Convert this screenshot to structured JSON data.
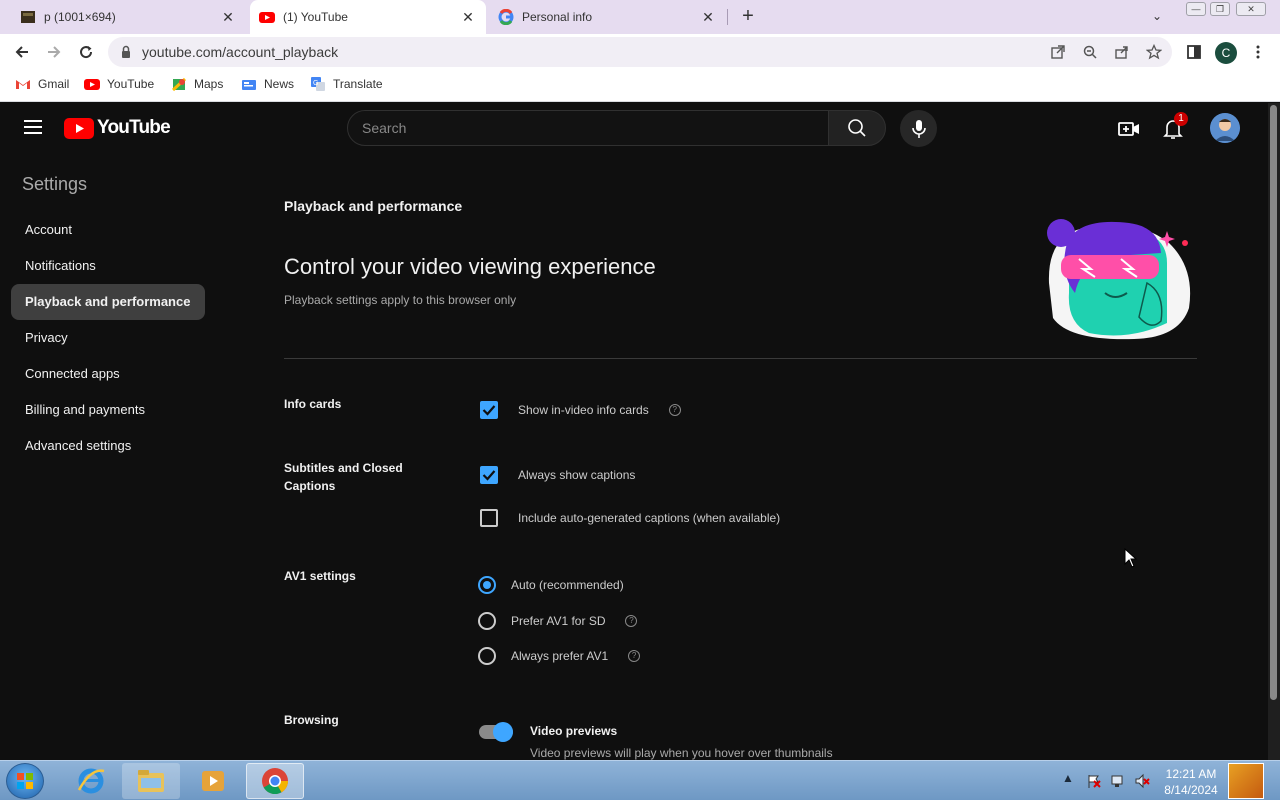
{
  "browser": {
    "tabs": [
      {
        "title": "p (1001×694)",
        "icon": "image-favicon"
      },
      {
        "title": "(1) YouTube",
        "icon": "youtube-favicon",
        "active": true
      },
      {
        "title": "Personal info",
        "icon": "google-favicon"
      }
    ],
    "url": "youtube.com/account_playback",
    "profile_initial": "C",
    "bookmarks": [
      "Gmail",
      "YouTube",
      "Maps",
      "News",
      "Translate"
    ]
  },
  "youtube": {
    "logo_text": "YouTube",
    "search_placeholder": "Search",
    "notification_count": "1"
  },
  "settings": {
    "title": "Settings",
    "nav": [
      "Account",
      "Notifications",
      "Playback and performance",
      "Privacy",
      "Connected apps",
      "Billing and payments",
      "Advanced settings"
    ],
    "active_nav": "Playback and performance"
  },
  "page": {
    "breadcrumb": "Playback and performance",
    "headline": "Control your video viewing experience",
    "subhead": "Playback settings apply to this browser only",
    "sections": {
      "info_cards": {
        "label": "Info cards",
        "options": [
          {
            "label": "Show in-video info cards",
            "checked": true
          }
        ]
      },
      "subtitles": {
        "label": "Subtitles and Closed Captions",
        "options": [
          {
            "label": "Always show captions",
            "checked": true
          },
          {
            "label": "Include auto-generated captions (when available)",
            "checked": false
          }
        ]
      },
      "av1": {
        "label": "AV1 settings",
        "options": [
          {
            "label": "Auto (recommended)",
            "selected": true
          },
          {
            "label": "Prefer AV1 for SD",
            "selected": false
          },
          {
            "label": "Always prefer AV1",
            "selected": false
          }
        ]
      },
      "browsing": {
        "label": "Browsing",
        "toggle_title": "Video previews",
        "toggle_desc": "Video previews will play when you hover over thumbnails",
        "toggle_on": true
      }
    }
  },
  "taskbar": {
    "time": "12:21 AM",
    "date": "8/14/2024"
  },
  "colors": {
    "accent": "#3ea6ff",
    "youtube_red": "#ff0000",
    "background": "#0f0f0f"
  }
}
